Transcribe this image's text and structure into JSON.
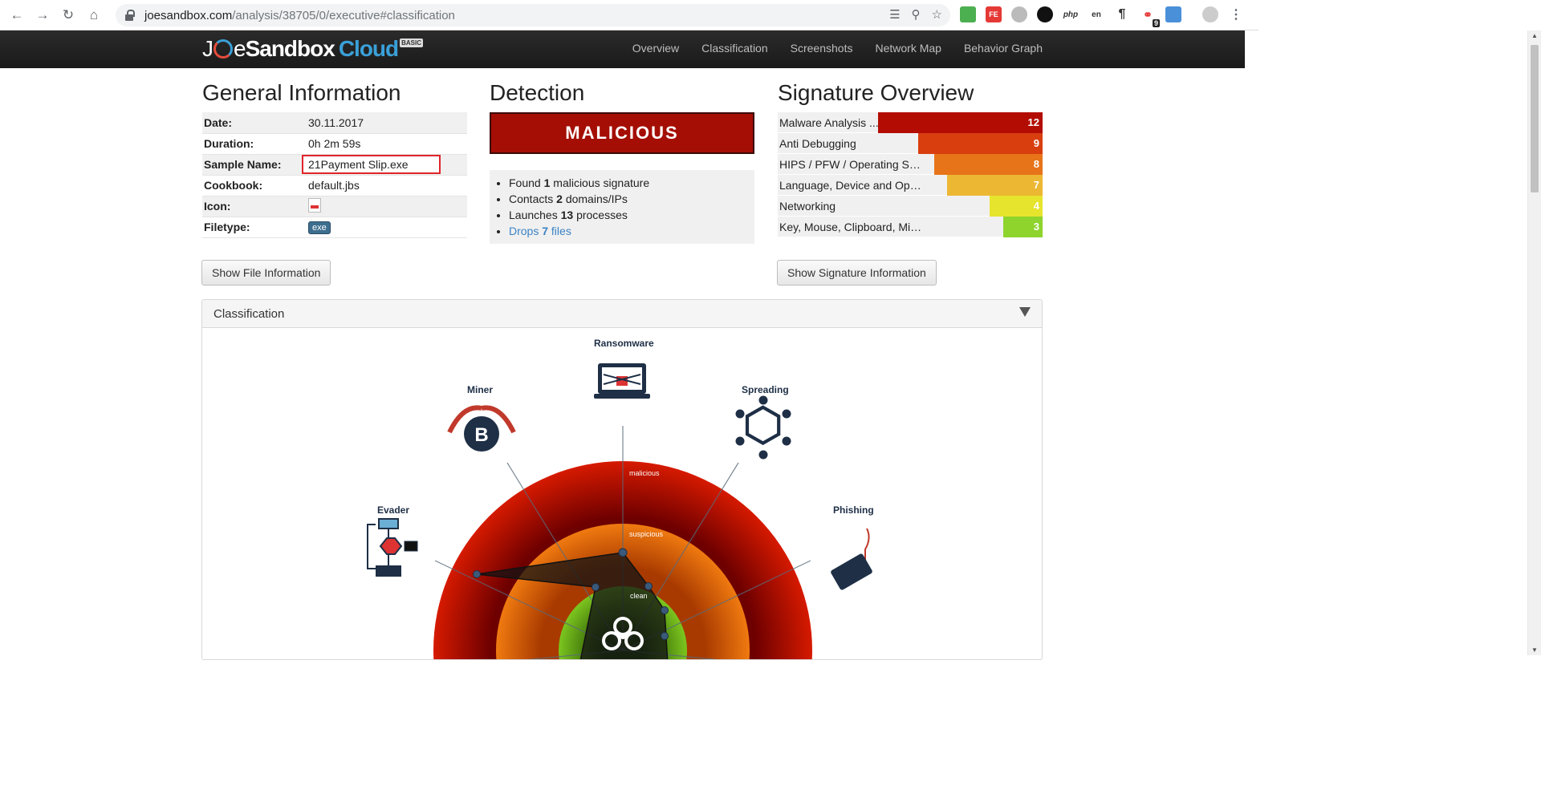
{
  "browser": {
    "url_host": "joesandbox.com",
    "url_path": "/analysis/38705/0/executive#classification",
    "extension_badge": "9"
  },
  "topnav": {
    "logo_joe": "J",
    "logo_e": "e",
    "logo_sandbox": "Sandbox",
    "logo_cloud": "Cloud",
    "logo_basic": "BASIC",
    "links": [
      "Overview",
      "Classification",
      "Screenshots",
      "Network Map",
      "Behavior Graph"
    ]
  },
  "general": {
    "title": "General Information",
    "rows": [
      {
        "key": "Date:",
        "value": "30.11.2017"
      },
      {
        "key": "Duration:",
        "value": "0h 2m 59s"
      },
      {
        "key": "Sample Name:",
        "value": "21Payment Slip.exe"
      },
      {
        "key": "Cookbook:",
        "value": "default.jbs"
      },
      {
        "key": "Icon:",
        "value": ""
      },
      {
        "key": "Filetype:",
        "value": "exe"
      }
    ],
    "button": "Show File Information"
  },
  "detection": {
    "title": "Detection",
    "verdict": "MALICIOUS",
    "items": [
      {
        "pre": "Found ",
        "num": "1",
        "post": " malicious signature"
      },
      {
        "pre": "Contacts ",
        "num": "2",
        "post": " domains/IPs"
      },
      {
        "pre": "Launches ",
        "num": "13",
        "post": " processes"
      },
      {
        "pre": "Drops ",
        "num": "7",
        "post": " files"
      }
    ]
  },
  "signatures": {
    "title": "Signature Overview",
    "rows": [
      {
        "label": "Malware Analysis ...",
        "value": "12",
        "fill": 0.62,
        "color": "#b30d03"
      },
      {
        "label": "Anti Debugging",
        "value": "9",
        "fill": 0.47,
        "color": "#d93e0f"
      },
      {
        "label": "HIPS / PFW / Operating Syste...",
        "value": "8",
        "fill": 0.41,
        "color": "#e77419"
      },
      {
        "label": "Language, Device and Operating ...",
        "value": "7",
        "fill": 0.36,
        "color": "#ecb733"
      },
      {
        "label": "Networking",
        "value": "4",
        "fill": 0.2,
        "color": "#e6e42d"
      },
      {
        "label": "Key, Mouse, Clipboard, Microphone and Scre...",
        "value": "3",
        "fill": 0.15,
        "color": "#8ed42c"
      }
    ],
    "button": "Show Signature Information"
  },
  "classification": {
    "title": "Classification",
    "categories": [
      "Ransomware",
      "Miner",
      "Spreading",
      "Evader",
      "Phishing"
    ],
    "rings": [
      "malicious",
      "suspicious",
      "clean"
    ]
  }
}
